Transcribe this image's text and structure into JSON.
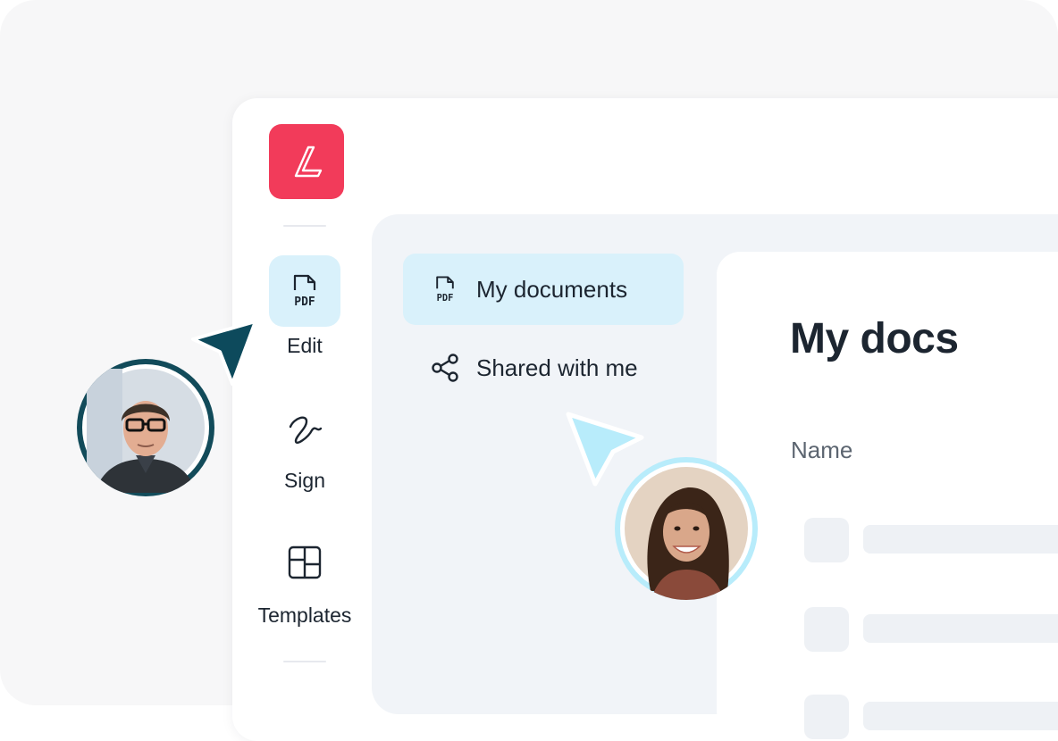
{
  "rail": {
    "items": [
      {
        "label": "Edit",
        "icon": "pdf-file-icon"
      },
      {
        "label": "Sign",
        "icon": "signature-icon"
      },
      {
        "label": "Templates",
        "icon": "templates-icon"
      }
    ]
  },
  "nav": {
    "items": [
      {
        "label": "My documents",
        "icon": "pdf-file-icon"
      },
      {
        "label": "Shared with me",
        "icon": "share-icon"
      }
    ]
  },
  "docs": {
    "title": "My docs",
    "column_name": "Name"
  },
  "colors": {
    "brand": "#f23b5a",
    "active_bg": "#d9f1fb",
    "cursor_dark": "#0d4a5c",
    "cursor_light": "#b8ecfb",
    "text": "#1c2530"
  }
}
